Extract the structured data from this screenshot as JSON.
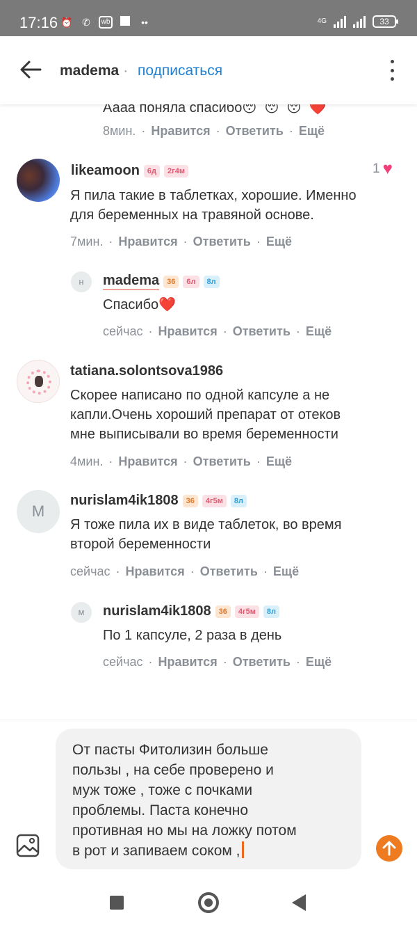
{
  "status_bar": {
    "time": "17:16",
    "network": "4G",
    "battery": "33"
  },
  "header": {
    "username": "madema",
    "dot": "·",
    "subscribe": "подписаться"
  },
  "top_partial": {
    "text": "Аааа поняла спасибо😴😴😴❤️",
    "time": "8мин.",
    "like": "Нравится",
    "reply": "Ответить",
    "more": "Ещё"
  },
  "comments": [
    {
      "username": "likeamoon",
      "badges": [
        "6д",
        "2г4м"
      ],
      "likes": "1",
      "text_line1": "Я пила такие в таблетках, хорошие. Именно",
      "text_line2": "для беременных на травяной основе.",
      "time": "7мин.",
      "like": "Нравится",
      "reply": "Ответить",
      "more": "Ещё"
    },
    {
      "avatar_letter": "н",
      "username": "madema",
      "badges": [
        "36",
        "6л",
        "8л"
      ],
      "text_line1": "Спасибо❤️",
      "time": "сейчас",
      "like": "Нравится",
      "reply": "Ответить",
      "more": "Ещё"
    },
    {
      "username": "tatiana.solontsova1986",
      "text_line1": "Скорее написано по одной капсуле а не",
      "text_line2": "капли.Очень хороший препарат от отеков",
      "text_line3": "мне выписывали во время беременности",
      "time": "4мин.",
      "like": "Нравится",
      "reply": "Ответить",
      "more": "Ещё"
    },
    {
      "avatar_letter": "M",
      "username": "nurislam4ik1808",
      "badges": [
        "36",
        "4г5м",
        "8л"
      ],
      "text_line1": "Я тоже пила их в виде таблеток, во время",
      "text_line2": "второй беременности",
      "time": "сейчас",
      "like": "Нравится",
      "reply": "Ответить",
      "more": "Ещё"
    },
    {
      "avatar_letter": "м",
      "username": "nurislam4ik1808",
      "badges": [
        "36",
        "4г5м",
        "8л"
      ],
      "text_line1": "По 1 капсуле, 2 раза в день",
      "time": "сейчас",
      "like": "Нравится",
      "reply": "Ответить",
      "more": "Ещё"
    }
  ],
  "composer": {
    "line1": "От пасты Фитолизин больше",
    "line2": "пользы , на себе проверено и",
    "line3": "муж тоже , тоже с почками",
    "line4": "проблемы. Паста конечно",
    "line5": "противная но мы на ложку потом",
    "line6": "в рот и запиваем соком ,"
  },
  "icons": {
    "back": "arrow-left-icon",
    "menu": "more-vertical-icon",
    "image": "image-icon",
    "send": "send-arrow-up-icon",
    "heart": "heart-icon"
  },
  "colors": {
    "accent": "#ee7b1f",
    "link": "#1f7fd1",
    "heart": "#f0407a",
    "meta": "#8a8f96"
  }
}
